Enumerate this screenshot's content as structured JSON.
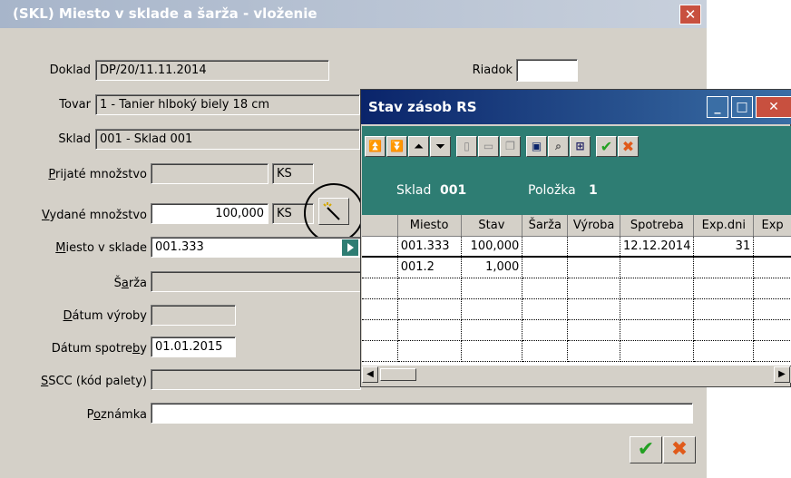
{
  "main": {
    "title": "(SKL) Miesto v sklade a šarža - vloženie",
    "close_glyph": "✕",
    "doklad": {
      "label": "Doklad",
      "value": "DP/20/11.11.2014"
    },
    "riadok": {
      "label": "Riadok",
      "value": ""
    },
    "tovar": {
      "label": "Tovar",
      "value": "1 - Tanier hlboký biely 18 cm"
    },
    "sklad": {
      "label": "Sklad",
      "value": "001 - Sklad 001"
    },
    "prijate": {
      "label_u": "P",
      "label_rest": "rijaté množstvo",
      "value": "",
      "unit": "KS"
    },
    "vydane": {
      "label_u": "V",
      "label_rest": "ydané množstvo",
      "value": "100,000",
      "unit": "KS"
    },
    "miesto": {
      "label_u": "M",
      "label_rest": "iesto v sklade",
      "value": "001.333"
    },
    "sarza": {
      "label_pre": "Š",
      "label_u": "a",
      "label_rest": "rža",
      "value": ""
    },
    "datum_vyroby": {
      "label_u": "D",
      "label_rest": "átum výroby",
      "value": ""
    },
    "datum_spotreby": {
      "label_pre": "Dátum spotre",
      "label_u": "b",
      "label_rest": "y",
      "value": "01.01.2015"
    },
    "sscc": {
      "label_pre": "",
      "label_u": "S",
      "label_rest": "SCC (kód palety)",
      "value": ""
    },
    "poznamka": {
      "label_pre": "P",
      "label_u": "o",
      "label_rest": "známka",
      "value": ""
    },
    "ok_glyph": "✔",
    "cancel_glyph": "✖"
  },
  "popup": {
    "title": "Stav zásob RS",
    "min_glyph": "_",
    "max_glyph": "□",
    "close_glyph": "✕",
    "sklad_label": "Sklad",
    "sklad_value": "001",
    "polozka_label": "Položka",
    "polozka_value": "1",
    "columns": [
      "Miesto",
      "Stav",
      "Šarža",
      "Výroba",
      "Spotreba",
      "Exp.dni",
      "Exp"
    ],
    "rows": [
      {
        "miesto": "001.333",
        "stav": "100,000",
        "sarza": "",
        "vyroba": "",
        "spotreba": "12.12.2014",
        "expdni": "31",
        "exp": ""
      },
      {
        "miesto": "001.2",
        "stav": "1,000",
        "sarza": "",
        "vyroba": "",
        "spotreba": "",
        "expdni": "",
        "exp": ""
      }
    ],
    "toolbar_icons": [
      "first-icon",
      "last-icon",
      "top-icon",
      "bottom-icon",
      "new-doc-icon",
      "open-icon",
      "copy-icon",
      "monitor-icon",
      "preview-icon",
      "grid-icon",
      "ok-icon",
      "cancel-icon"
    ],
    "scroll_left_glyph": "◀",
    "scroll_right_glyph": "▶"
  },
  "colors": {
    "title_inactive": "#a7b5ca",
    "title_active": "#0a246a",
    "teal": "#2e7d73",
    "ok_green": "#22a022",
    "cancel_orange": "#e05a1a"
  }
}
